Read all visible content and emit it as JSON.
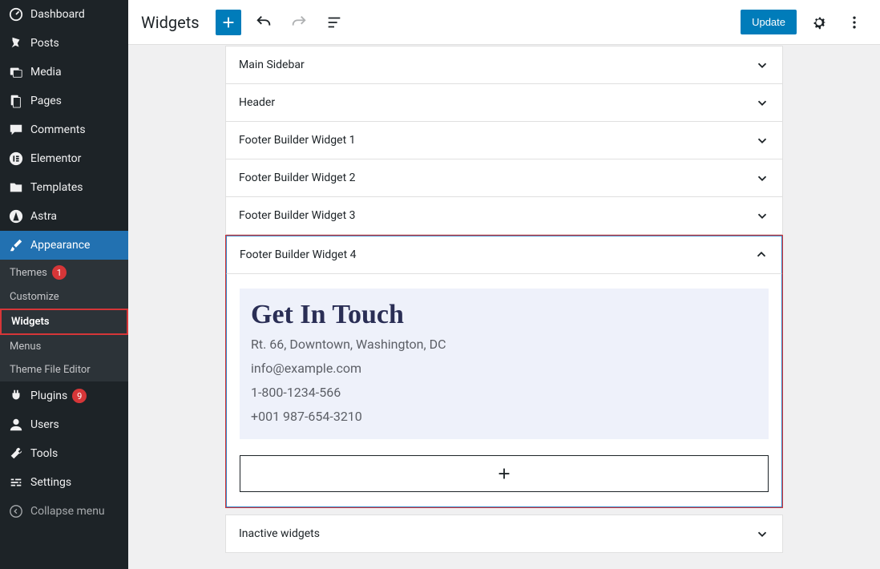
{
  "header": {
    "title": "Widgets",
    "update_label": "Update"
  },
  "sidebar": {
    "items": [
      {
        "label": "Dashboard"
      },
      {
        "label": "Posts"
      },
      {
        "label": "Media"
      },
      {
        "label": "Pages"
      },
      {
        "label": "Comments"
      },
      {
        "label": "Elementor"
      },
      {
        "label": "Templates"
      },
      {
        "label": "Astra"
      },
      {
        "label": "Appearance"
      },
      {
        "label": "Plugins",
        "badge": "9"
      },
      {
        "label": "Users"
      },
      {
        "label": "Tools"
      },
      {
        "label": "Settings"
      },
      {
        "label": "Collapse menu"
      }
    ],
    "appearance_sub": [
      {
        "label": "Themes",
        "badge": "1"
      },
      {
        "label": "Customize"
      },
      {
        "label": "Widgets"
      },
      {
        "label": "Menus"
      },
      {
        "label": "Theme File Editor"
      }
    ]
  },
  "panels": [
    {
      "title": "Main Sidebar"
    },
    {
      "title": "Header"
    },
    {
      "title": "Footer Builder Widget 1"
    },
    {
      "title": "Footer Builder Widget 2"
    },
    {
      "title": "Footer Builder Widget 3"
    },
    {
      "title": "Footer Builder Widget 4"
    },
    {
      "title": "Inactive widgets"
    }
  ],
  "widget4": {
    "heading": "Get In Touch",
    "lines": [
      "Rt. 66, Downtown, Washington, DC",
      "info@example.com",
      "1-800-1234-566",
      "+001 987-654-3210"
    ]
  }
}
